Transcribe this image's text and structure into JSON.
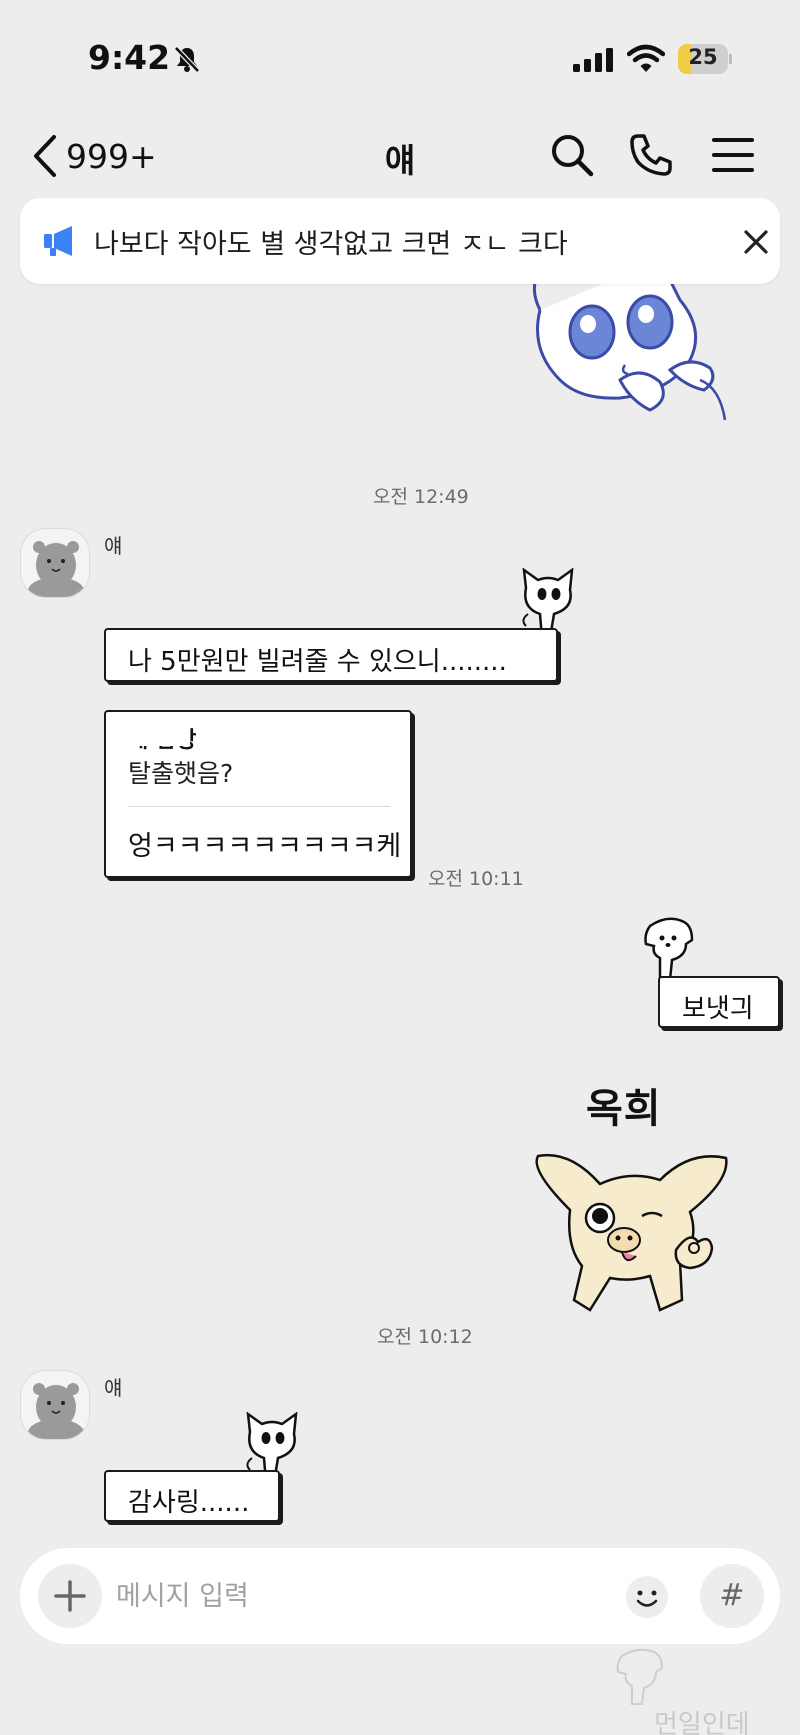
{
  "status_bar": {
    "time": "9:42",
    "battery": "25",
    "battery_level": 0.25,
    "battery_color": "#f3cc45",
    "icons": [
      "bell-off-icon",
      "cellular-signal-icon",
      "wifi-icon",
      "battery-icon"
    ]
  },
  "header": {
    "back_count": "999+",
    "title": "얘",
    "icons": [
      "chevron-left-icon",
      "search-icon",
      "phone-icon",
      "hamburger-menu-icon"
    ]
  },
  "notice": {
    "text": "나보다 작아도 별 생각없고 크면 ㅈㄴ 크다",
    "icons": [
      "megaphone-icon",
      "close-icon"
    ],
    "accent": "#3b82f6"
  },
  "messages": [
    {
      "type": "timestamp",
      "text": "오전 12:49"
    },
    {
      "type": "incoming",
      "sender": "얘",
      "text": "나 5만원만 빌려줄 수 있으니........"
    },
    {
      "type": "incoming-reply",
      "reply_header": "게 답장",
      "quoted": "탈출햇음?",
      "text": "엉ㅋㅋㅋㅋㅋㅋㅋㅋㅋ케",
      "time": "오전 10:11"
    },
    {
      "type": "outgoing",
      "text": "보냇긔"
    },
    {
      "type": "outgoing-sticker",
      "caption": "옥희"
    },
    {
      "type": "timestamp",
      "text": "오전 10:12"
    },
    {
      "type": "incoming",
      "sender": "얘",
      "text": "감사링......"
    }
  ],
  "input": {
    "placeholder": "메시지 입력",
    "value": "",
    "icons": [
      "plus-icon",
      "emoji-icon",
      "hashtag-icon"
    ],
    "hash_glyph": "#"
  },
  "watermark": "먼일인데"
}
